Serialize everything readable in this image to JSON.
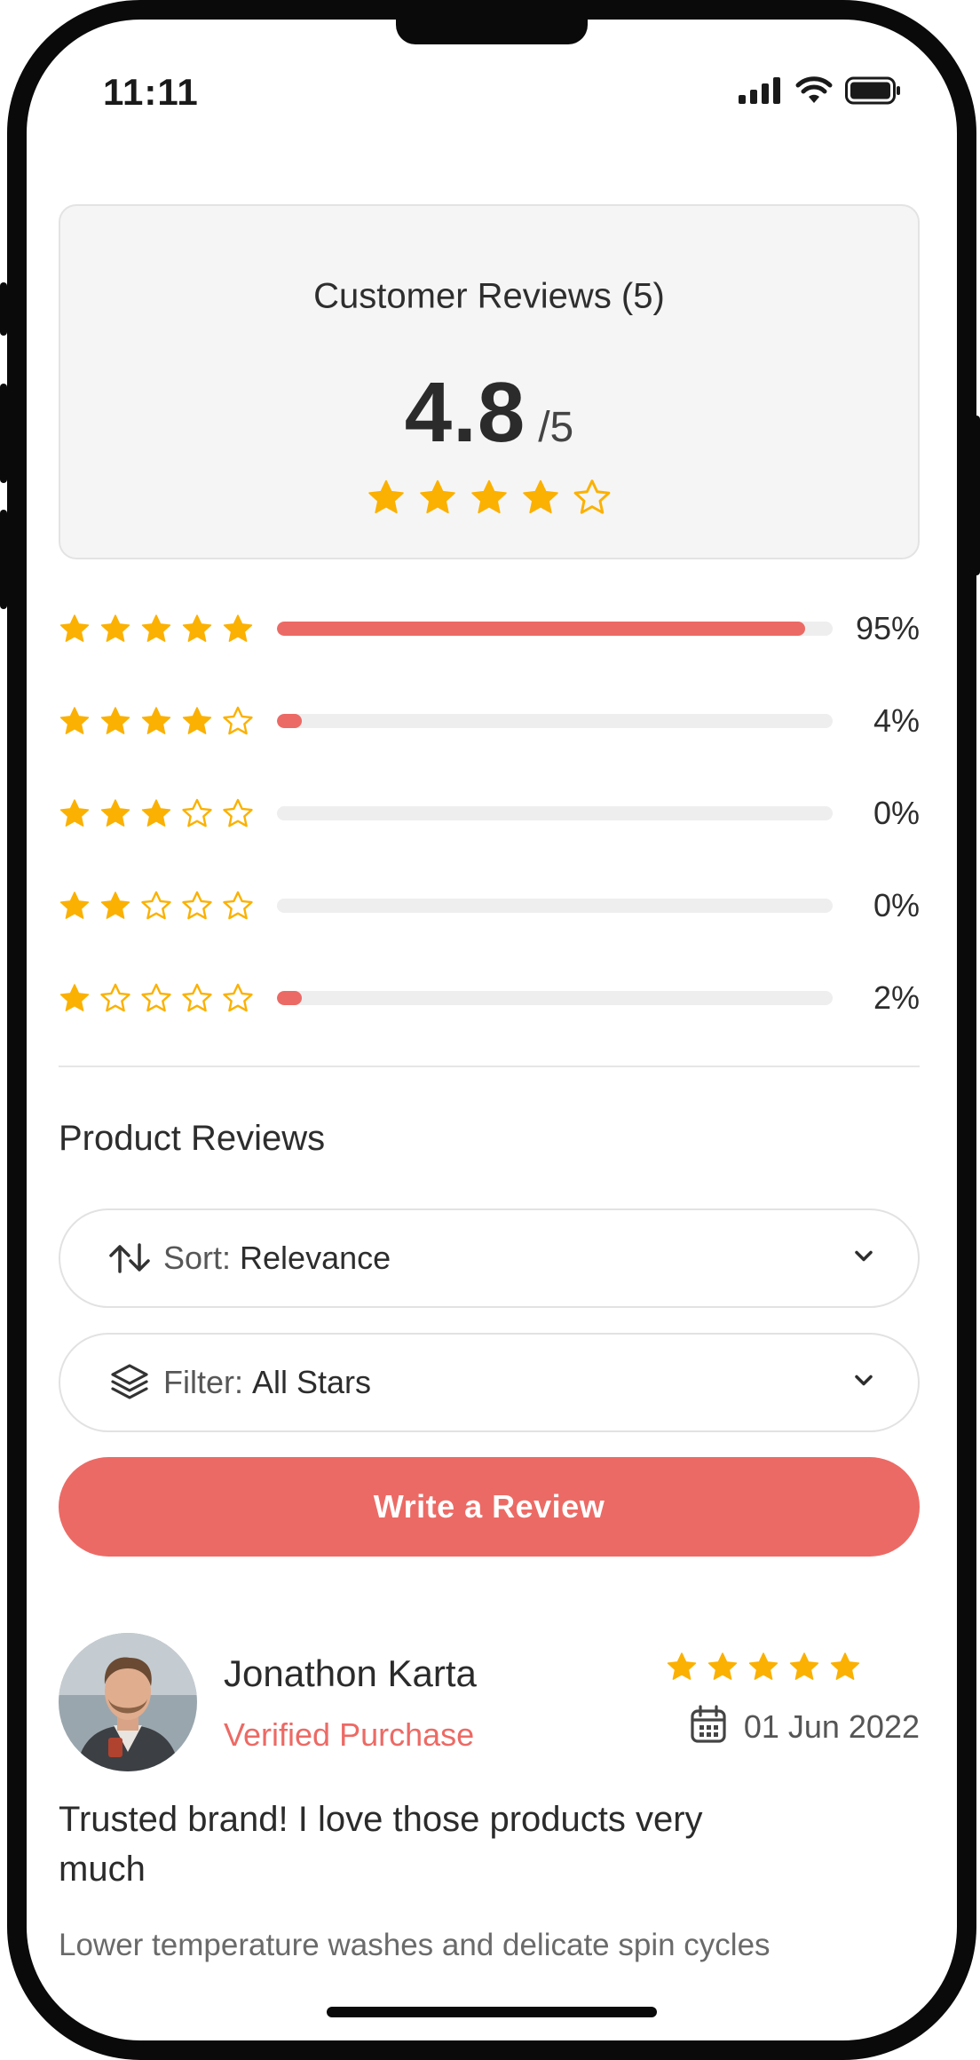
{
  "status_bar": {
    "time": "11:11",
    "icons": [
      "signal-icon",
      "wifi-icon",
      "battery-icon"
    ]
  },
  "summary": {
    "title": "Customer Reviews (5)",
    "score": "4.8",
    "out_of": "/5",
    "stars_filled": 4,
    "stars_total": 5
  },
  "distribution": [
    {
      "stars": 5,
      "fraction": 0.95,
      "percent_label": "95%"
    },
    {
      "stars": 4,
      "fraction": 0.04,
      "percent_label": "4%"
    },
    {
      "stars": 3,
      "fraction": 0.0,
      "percent_label": "0%"
    },
    {
      "stars": 2,
      "fraction": 0.0,
      "percent_label": "0%"
    },
    {
      "stars": 1,
      "fraction": 0.02,
      "percent_label": "2%"
    }
  ],
  "product_reviews": {
    "title": "Product Reviews",
    "sort": {
      "label": "Sort:",
      "value": "Relevance",
      "icon": "sort-arrows-icon"
    },
    "filter": {
      "label": "Filter:",
      "value": "All Stars",
      "icon": "layers-icon"
    },
    "write_button": "Write a Review"
  },
  "reviews": [
    {
      "name": "Jonathon Karta",
      "badge": "Verified Purchase",
      "stars": 5,
      "date": "01 Jun 2022",
      "title": "Trusted brand! I love those products very much",
      "body": "Lower temperature washes and delicate spin cycles"
    }
  ],
  "colors": {
    "accent": "#ec6a65",
    "star": "#fbb101",
    "card_bg": "#f5f5f5",
    "track": "#eeeeee"
  }
}
